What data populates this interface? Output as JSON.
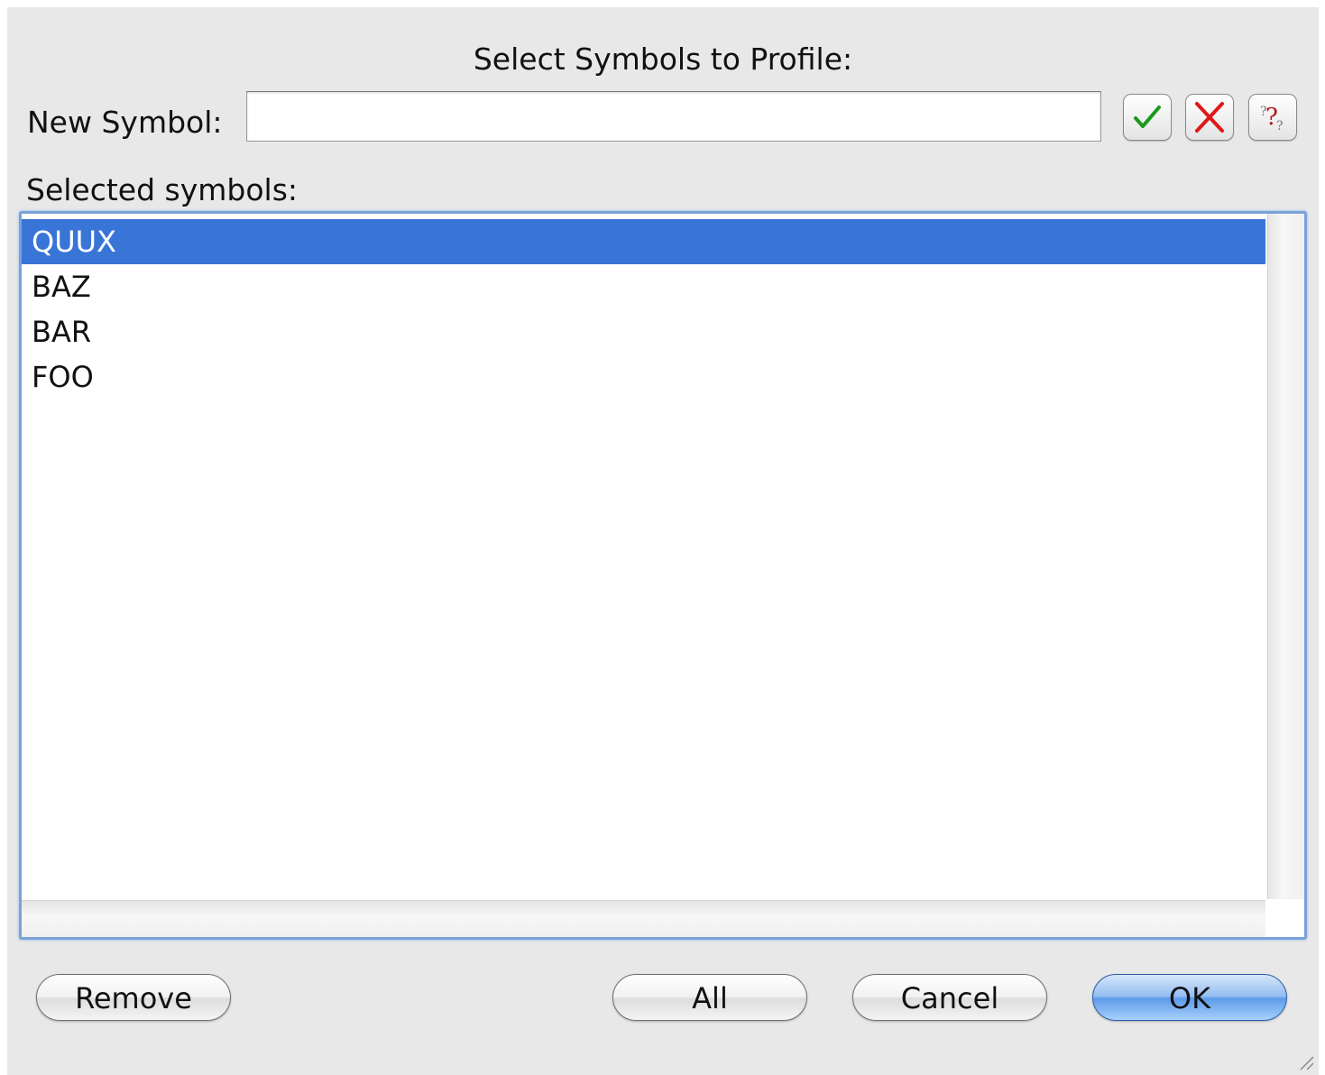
{
  "dialog": {
    "title": "Select Symbols to Profile:",
    "new_symbol_label": "New Symbol:",
    "new_symbol_value": "",
    "selected_symbols_label": "Selected symbols:"
  },
  "icons": {
    "accept": "checkmark-icon",
    "reject": "red-x-icon",
    "help": "question-mark-icon"
  },
  "list": {
    "items": [
      {
        "label": "QUUX",
        "selected": true
      },
      {
        "label": "BAZ",
        "selected": false
      },
      {
        "label": "BAR",
        "selected": false
      },
      {
        "label": "FOO",
        "selected": false
      }
    ]
  },
  "buttons": {
    "remove": "Remove",
    "all": "All",
    "cancel": "Cancel",
    "ok": "OK"
  },
  "colors": {
    "selection": "#3875d7",
    "default_button": "#5c9bea"
  }
}
